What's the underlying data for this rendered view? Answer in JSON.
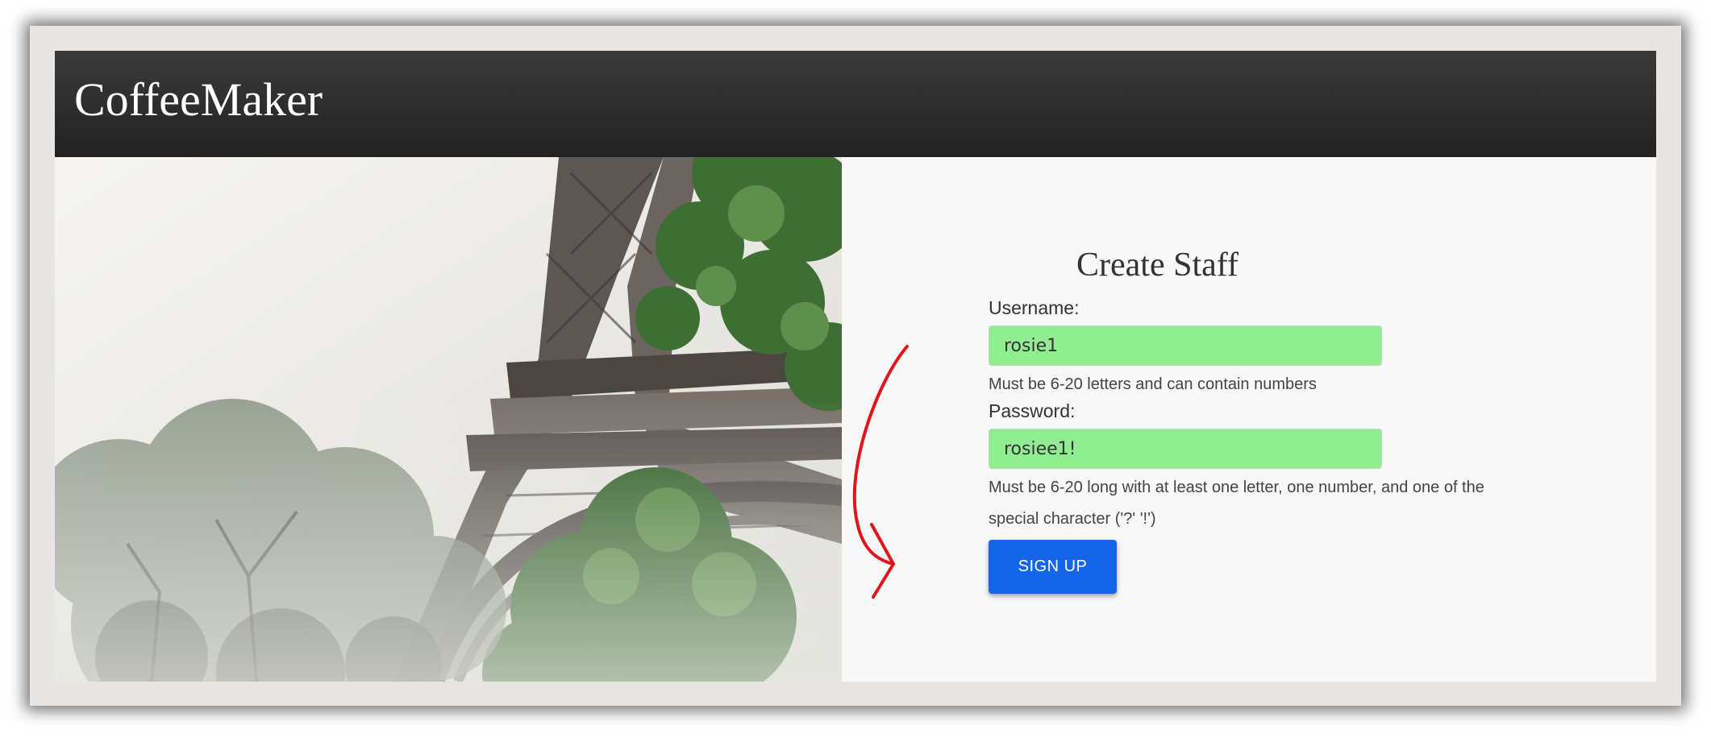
{
  "app": {
    "brand": "CoffeeMaker"
  },
  "form": {
    "title": "Create Staff",
    "username": {
      "label": "Username:",
      "value": "rosie1",
      "help": "Must be 6-20 letters and can contain numbers"
    },
    "password": {
      "label": "Password:",
      "value": "rosiee1!",
      "help": "Must be 6-20 long with at least one letter, one number, and one of the special character ('?' '!')"
    },
    "submit_label": "SIGN UP"
  },
  "colors": {
    "header": "#2b2b2b",
    "valid_field": "#90ee90",
    "primary_button": "#1565e8",
    "annotation_arrow": "#e0161e"
  },
  "icons": {
    "annotation": "curved-arrow-icon"
  }
}
